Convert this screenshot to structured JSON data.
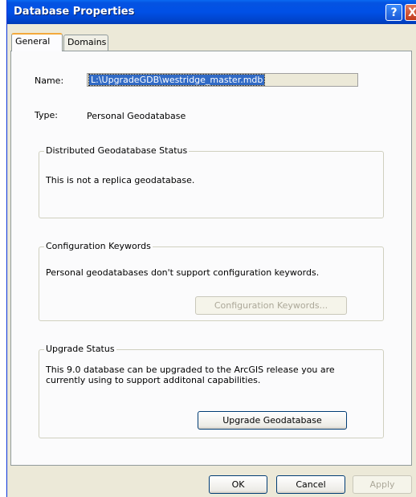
{
  "window": {
    "title": "Database Properties",
    "help_label": "?",
    "close_label": "X"
  },
  "tabs": [
    {
      "label": "General",
      "active": true
    },
    {
      "label": "Domains",
      "active": false
    }
  ],
  "general": {
    "name_label": "Name:",
    "name_value": "L:\\UpgradeGDB\\westridge_master.mdb",
    "type_label": "Type:",
    "type_value": "Personal Geodatabase",
    "distributed": {
      "title": "Distributed Geodatabase Status",
      "text": "This is not a replica geodatabase."
    },
    "config": {
      "title": "Configuration Keywords",
      "text": "Personal geodatabases don't support configuration keywords.",
      "button_label": "Configuration Keywords..."
    },
    "upgrade": {
      "title": "Upgrade Status",
      "text_line1": "This 9.0 database can be upgraded to the ArcGIS release you are",
      "text_line2": "currently using to support additonal capabilities.",
      "button_label": "Upgrade Geodatabase"
    }
  },
  "footer": {
    "ok_label": "OK",
    "cancel_label": "Cancel",
    "apply_label": "Apply"
  }
}
